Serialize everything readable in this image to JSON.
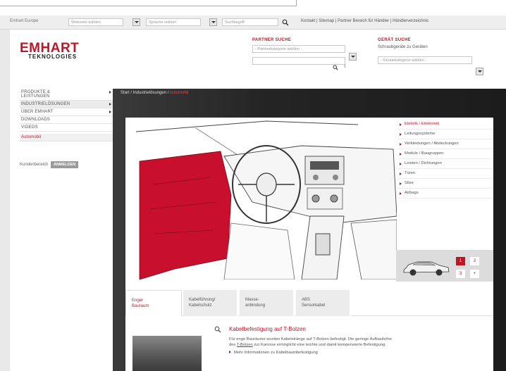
{
  "topbar": {
    "region": "Emhart Europe",
    "website_select": "Webseite wählen",
    "language_select": "Sprache wählen",
    "search_placeholder": "Suchbegriff",
    "links": "Kontakt  |  Sitemap  |  Partner Bereich für Händler  |  Händlerverzeichnis"
  },
  "logo": {
    "line1": "EMHART",
    "line2": "TEKNOLOGIES"
  },
  "partner_finder": {
    "title": "PARTNER SUCHE",
    "select": "- Partnerkategorie wählen -",
    "search_glyph": "⌕",
    "info_glyph": "i"
  },
  "device_finder": {
    "title": "GERÄT SUCHE",
    "text": "Schraubgeräte zu Geräten",
    "select": "- Gerätekategorie wählen -"
  },
  "sidebar": {
    "items": [
      {
        "label": "PRODUKTE &",
        "label2": "LEISTUNGEN",
        "arrow": true,
        "state": "normal"
      },
      {
        "label": "INDUSTRIELÖSUNGEN",
        "arrow": true,
        "state": "active"
      },
      {
        "label": "ÜBER EMHART",
        "arrow": true,
        "state": "normal"
      },
      {
        "label": "DOWNLOADS",
        "arrow": false,
        "state": "normal"
      },
      {
        "label": "VIDEOS",
        "arrow": false,
        "state": "normal"
      },
      {
        "label": "Automobil",
        "arrow": false,
        "state": "red"
      }
    ],
    "kunden_label": "Kundenbereich",
    "kunden_button": "ANMELDEN"
  },
  "hero": {
    "breadcrumb": "Start / Industrielösungen / ",
    "breadcrumb_current": "Automobil"
  },
  "categories": [
    {
      "label": "Elektrik / Elektronik",
      "active": true
    },
    {
      "label": "Leitungssysteme",
      "active": false
    },
    {
      "label": "Verkleidungen / Abdeckungen",
      "active": false
    },
    {
      "label": "Module / Baugruppen",
      "active": false
    },
    {
      "label": "Leisten / Dichtungen",
      "active": false
    },
    {
      "label": "Türen",
      "active": false
    },
    {
      "label": "Sitze",
      "active": false
    },
    {
      "label": "Airbags",
      "active": false
    }
  ],
  "pagination": [
    "1",
    "2",
    "3",
    "+"
  ],
  "tabs": [
    {
      "label": "Enger",
      "label2": "Bauraum",
      "active": true
    },
    {
      "label": "Kabelführung/",
      "label2": "Kabelschutz",
      "active": false
    },
    {
      "label": "Masse-",
      "label2": "anbindung",
      "active": false
    },
    {
      "label": "ABS",
      "label2": "Sensorkabel",
      "active": false
    }
  ],
  "article": {
    "title": "Kabelbefestigung auf T-Bolzen",
    "body1": "Für enge Bauräume wurden Kabelstränge auf T-Bolzen befestigt. Die geringe Aufbauhöhe",
    "body2_pre": "des ",
    "body2_link": "T-Bolzen",
    "body2_post": " zur Karosse ermöglicht eine leichte und damit kompensierte Befestigung.",
    "more": "Mehr Informationen zu Kabelbaumbefestigung"
  },
  "colors": {
    "brand_red": "#c01525",
    "dark_bg": "#2c2c2c"
  }
}
